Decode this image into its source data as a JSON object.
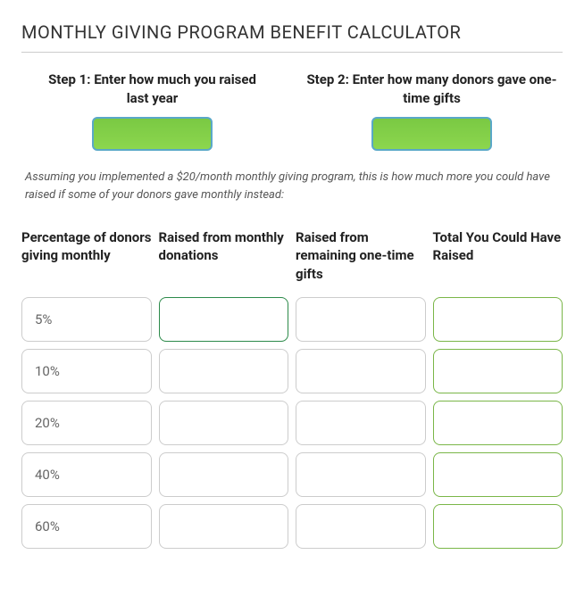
{
  "title": "MONTHLY GIVING PROGRAM BENEFIT CALCULATOR",
  "steps": {
    "step1": {
      "label": "Step 1: Enter how much you raised\nlast year",
      "value": ""
    },
    "step2": {
      "label": "Step 2: Enter how many donors gave one-time gifts",
      "value": ""
    }
  },
  "assumption": "Assuming you implemented a $20/month monthly giving program, this is how much more you could have raised if some of your donors gave monthly instead:",
  "columns": {
    "percent": "Percentage of donors giving monthly",
    "monthly": "Raised from monthly donations",
    "onetime": "Raised from remaining one-time gifts",
    "total": "Total You Could Have Raised"
  },
  "rows": [
    {
      "percent": "5%",
      "monthly": "",
      "onetime": "",
      "total": ""
    },
    {
      "percent": "10%",
      "monthly": "",
      "onetime": "",
      "total": ""
    },
    {
      "percent": "20%",
      "monthly": "",
      "onetime": "",
      "total": ""
    },
    {
      "percent": "40%",
      "monthly": "",
      "onetime": "",
      "total": ""
    },
    {
      "percent": "60%",
      "monthly": "",
      "onetime": "",
      "total": ""
    }
  ]
}
